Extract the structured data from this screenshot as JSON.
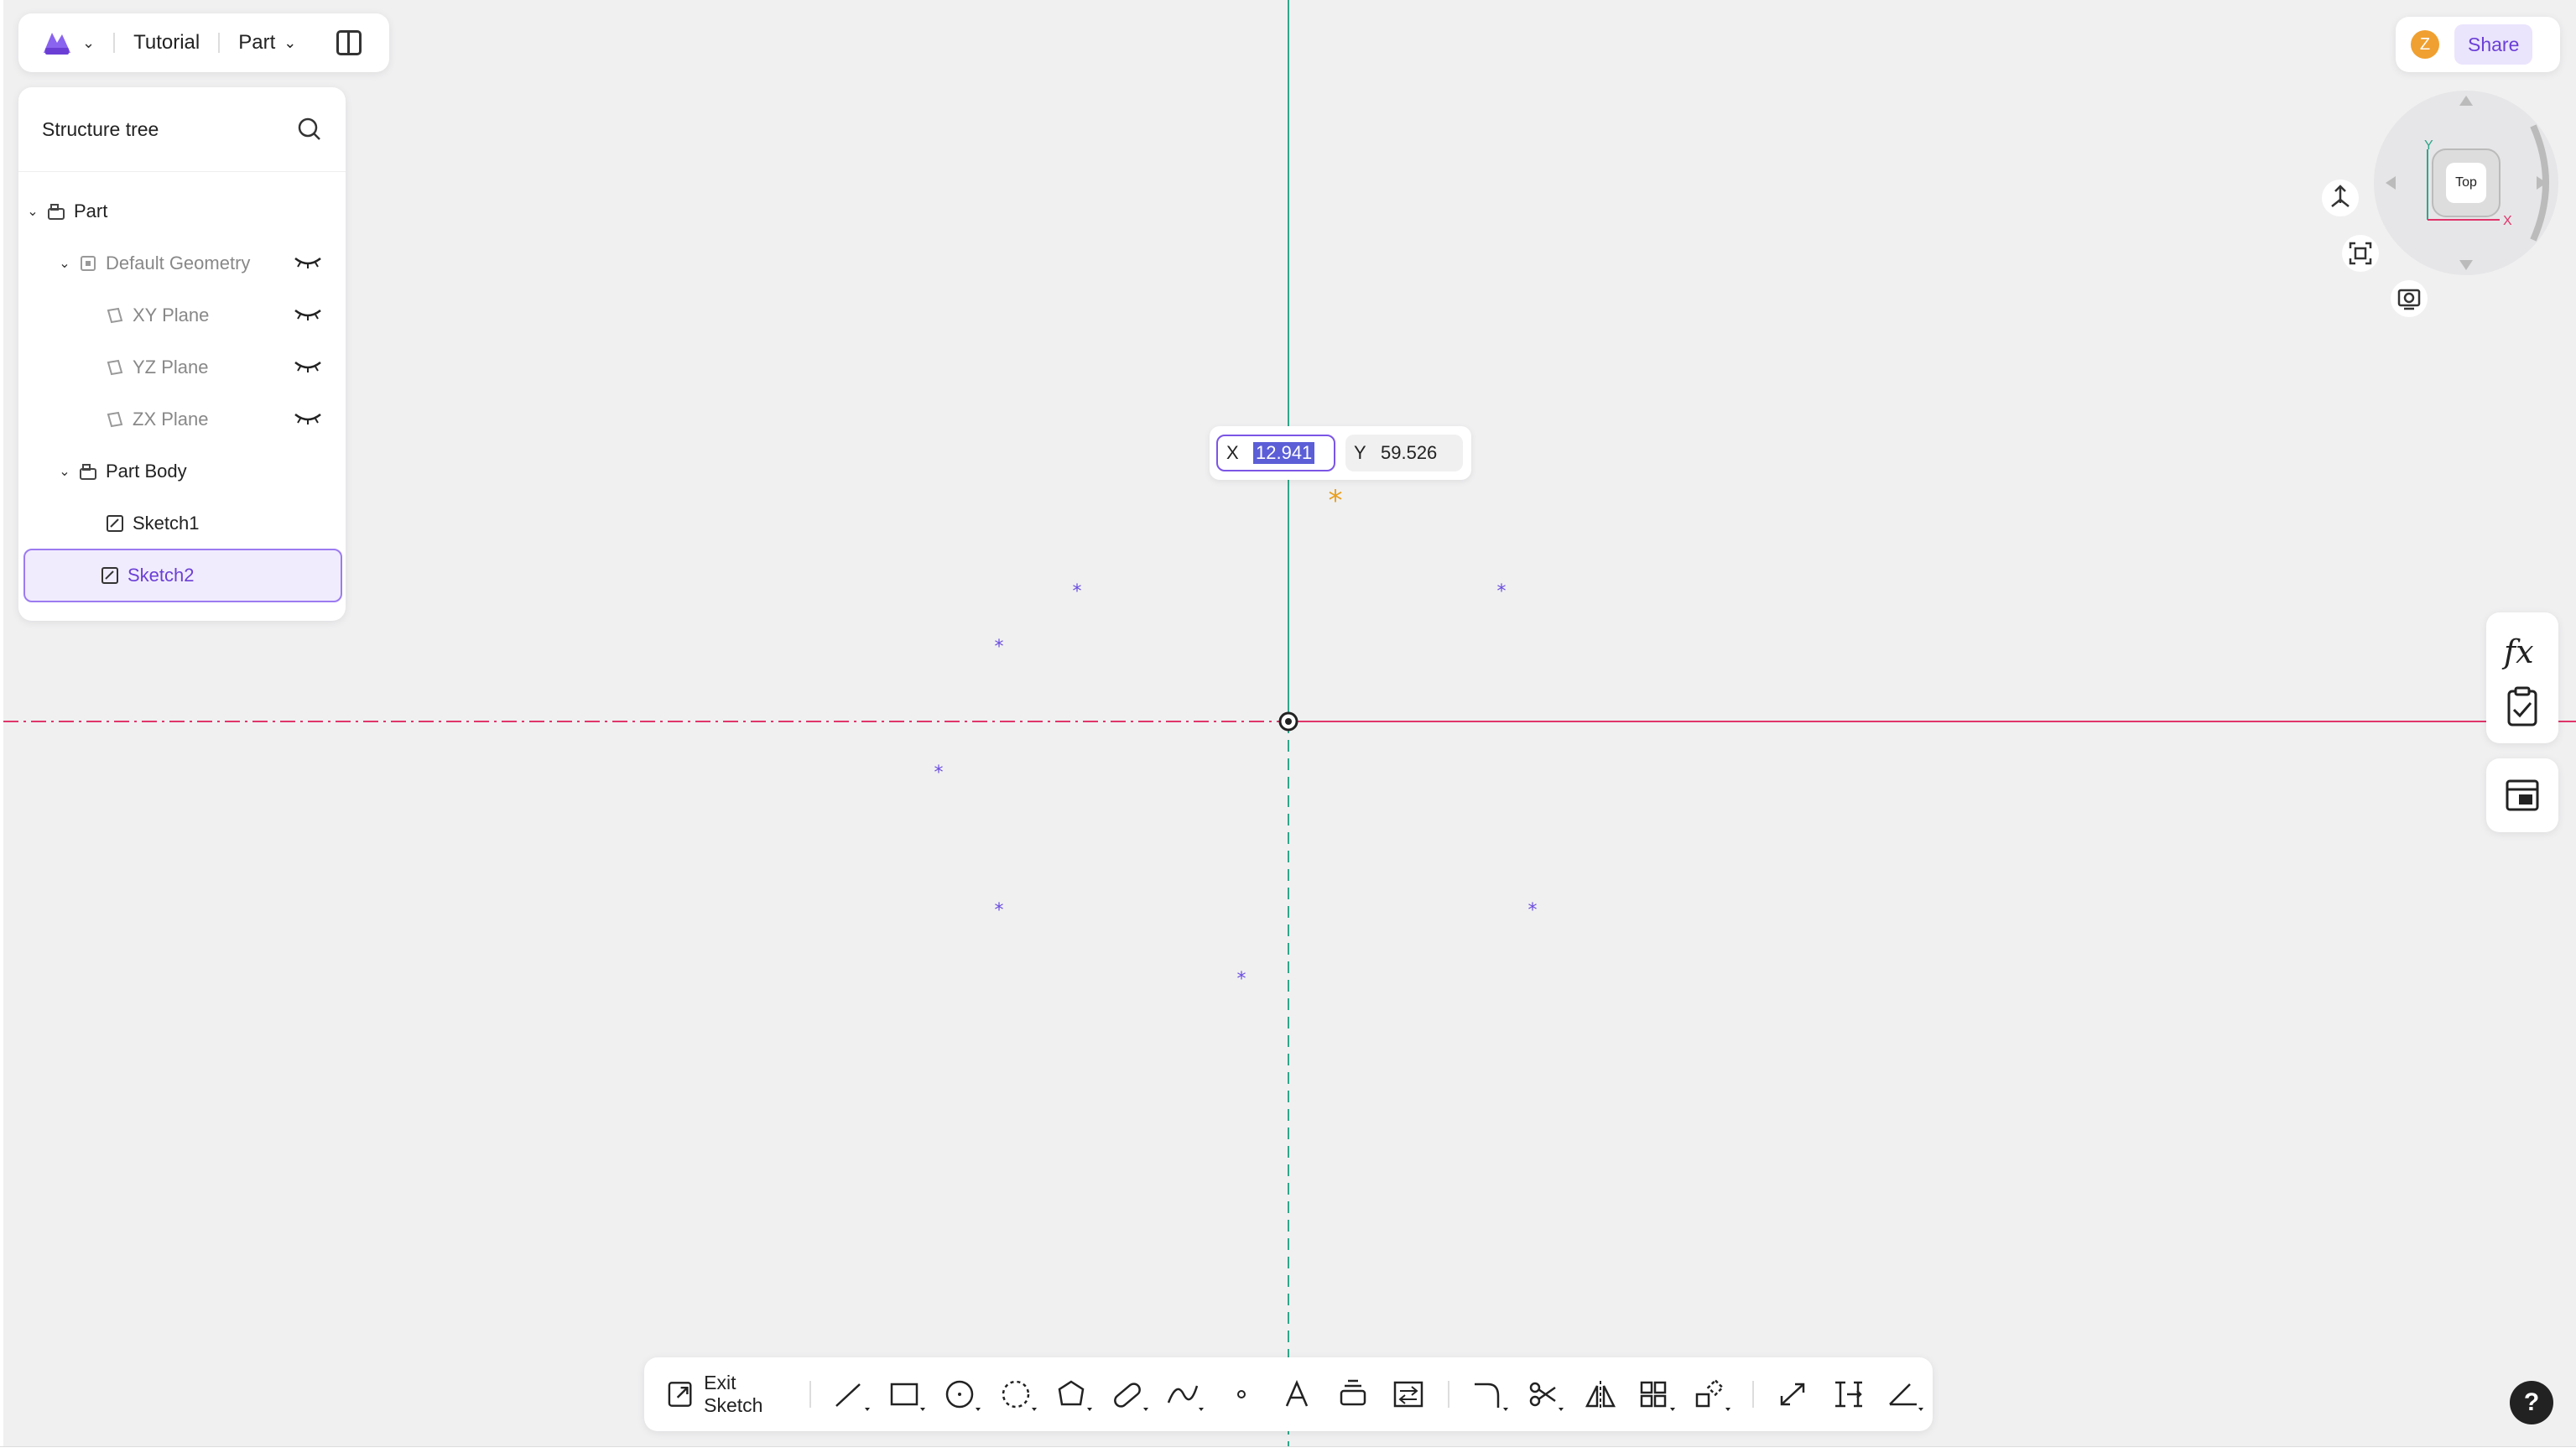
{
  "topbar": {
    "project": "Tutorial",
    "mode": "Part"
  },
  "tree": {
    "title": "Structure tree",
    "items": [
      {
        "label": "Part"
      },
      {
        "label": "Default Geometry"
      },
      {
        "label": "XY Plane"
      },
      {
        "label": "YZ Plane"
      },
      {
        "label": "ZX Plane"
      },
      {
        "label": "Part Body"
      },
      {
        "label": "Sketch1"
      },
      {
        "label": "Sketch2"
      }
    ]
  },
  "coord": {
    "x_label": "X",
    "x_value": "12.941",
    "y_label": "Y",
    "y_value": "59.526"
  },
  "user": {
    "initial": "Z",
    "share_label": "Share"
  },
  "viewcube": {
    "face": "Top",
    "axis_x": "X",
    "axis_y": "Y"
  },
  "toolbar": {
    "exit_label": "Exit Sketch"
  },
  "help": "?",
  "colors": {
    "accent": "#7b55e6",
    "x_axis": "#e0356a",
    "y_axis": "#2fa78a",
    "point": "#6a4de0",
    "cursor_point": "#e8a020"
  }
}
